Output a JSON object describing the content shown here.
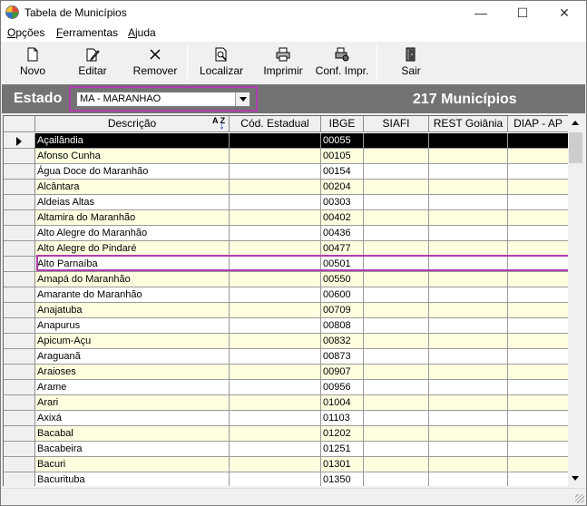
{
  "window": {
    "title": "Tabela de Municípios",
    "controls": [
      "—",
      "☐",
      "✕"
    ]
  },
  "menu": [
    {
      "mnemonic": "O",
      "rest": "pções"
    },
    {
      "mnemonic": "F",
      "rest": "erramentas"
    },
    {
      "mnemonic": "A",
      "rest": "juda"
    }
  ],
  "toolbar": {
    "novo": "Novo",
    "editar": "Editar",
    "remover": "Remover",
    "localizar": "Localizar",
    "imprimir": "Imprimir",
    "conf_impr": "Conf. Impr.",
    "sair": "Sair"
  },
  "estado": {
    "label": "Estado",
    "selected": "MA - MARANHAO",
    "count_text": "217 Municípios"
  },
  "grid": {
    "columns": [
      "Descrição",
      "Cód. Estadual",
      "IBGE",
      "SIAFI",
      "REST Goiânia",
      "DIAP - AP"
    ],
    "sort_icon_text": "A Z",
    "selected_row": 0,
    "highlighted_row": 8,
    "rows": [
      [
        "Açailândia",
        "",
        "00055",
        "",
        "",
        ""
      ],
      [
        "Afonso Cunha",
        "",
        "00105",
        "",
        "",
        ""
      ],
      [
        "Água Doce do Maranhão",
        "",
        "00154",
        "",
        "",
        ""
      ],
      [
        "Alcântara",
        "",
        "00204",
        "",
        "",
        ""
      ],
      [
        "Aldeias Altas",
        "",
        "00303",
        "",
        "",
        ""
      ],
      [
        "Altamira do Maranhão",
        "",
        "00402",
        "",
        "",
        ""
      ],
      [
        "Alto Alegre do Maranhão",
        "",
        "00436",
        "",
        "",
        ""
      ],
      [
        "Alto Alegre do Pindaré",
        "",
        "00477",
        "",
        "",
        ""
      ],
      [
        "Alto Parnaíba",
        "",
        "00501",
        "",
        "",
        ""
      ],
      [
        "Amapá do Maranhão",
        "",
        "00550",
        "",
        "",
        ""
      ],
      [
        "Amarante do Maranhão",
        "",
        "00600",
        "",
        "",
        ""
      ],
      [
        "Anajatuba",
        "",
        "00709",
        "",
        "",
        ""
      ],
      [
        "Anapurus",
        "",
        "00808",
        "",
        "",
        ""
      ],
      [
        "Apicum-Açu",
        "",
        "00832",
        "",
        "",
        ""
      ],
      [
        "Araguanã",
        "",
        "00873",
        "",
        "",
        ""
      ],
      [
        "Araioses",
        "",
        "00907",
        "",
        "",
        ""
      ],
      [
        "Arame",
        "",
        "00956",
        "",
        "",
        ""
      ],
      [
        "Arari",
        "",
        "01004",
        "",
        "",
        ""
      ],
      [
        "Axixá",
        "",
        "01103",
        "",
        "",
        ""
      ],
      [
        "Bacabal",
        "",
        "01202",
        "",
        "",
        ""
      ],
      [
        "Bacabeira",
        "",
        "01251",
        "",
        "",
        ""
      ],
      [
        "Bacuri",
        "",
        "01301",
        "",
        "",
        ""
      ],
      [
        "Bacurituba",
        "",
        "01350",
        "",
        "",
        ""
      ]
    ]
  }
}
